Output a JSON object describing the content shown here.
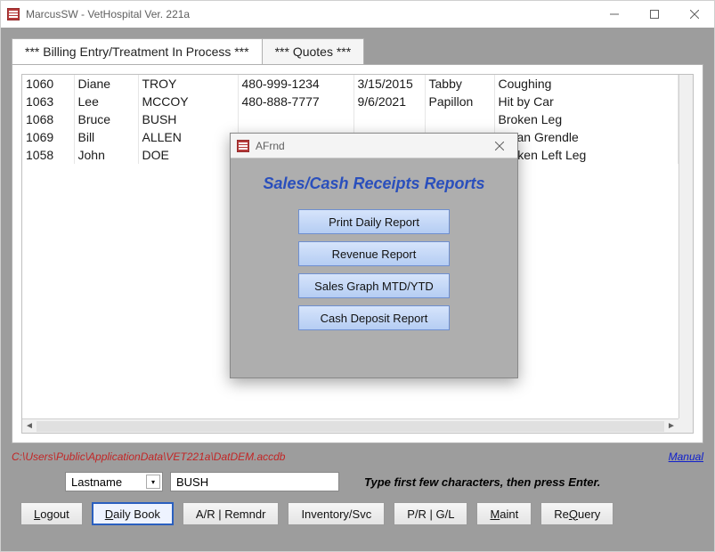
{
  "window": {
    "title": "MarcusSW - VetHospital Ver. 221a"
  },
  "tabs": {
    "active": "*** Billing Entry/Treatment In Process ***",
    "inactive": "*** Quotes ***"
  },
  "grid": {
    "rows": [
      {
        "id": "1060",
        "first": "Diane",
        "last": "TROY",
        "phone": "480-999-1234",
        "date": "3/15/2015",
        "breed": "Tabby",
        "issue": "Coughing"
      },
      {
        "id": "1063",
        "first": "Lee",
        "last": "MCCOY",
        "phone": "480-888-7777",
        "date": "9/6/2021",
        "breed": "Papillon",
        "issue": "Hit by Car"
      },
      {
        "id": "1068",
        "first": "Bruce",
        "last": "BUSH",
        "phone": "",
        "date": "",
        "breed": "",
        "issue": "Broken Leg"
      },
      {
        "id": "1069",
        "first": "Bill",
        "last": "ALLEN",
        "phone": "",
        "date": "",
        "breed": "",
        "issue": "Clean Grendle"
      },
      {
        "id": "1058",
        "first": "John",
        "last": "DOE",
        "phone": "",
        "date": "",
        "breed": "",
        "issue": "Broken Left Leg"
      }
    ]
  },
  "path": "C:\\Users\\Public\\ApplicationData\\VET221a\\DatDEM.accdb",
  "manual_link": "Manual",
  "search": {
    "combo_value": "Lastname",
    "input_value": "BUSH",
    "hint": "Type first few characters, then press Enter."
  },
  "buttons": {
    "logout": "Logout",
    "daily_book": "Daily Book",
    "ar_remndr": "A/R | Remndr",
    "inventory": "Inventory/Svc",
    "pr_gl": "P/R | G/L",
    "maint": "Maint",
    "requery": "ReQuery"
  },
  "modal": {
    "title": "AFrnd",
    "heading": "Sales/Cash Receipts Reports",
    "b1": "Print Daily Report",
    "b2": "Revenue Report",
    "b3": "Sales Graph MTD/YTD",
    "b4": "Cash Deposit Report"
  }
}
